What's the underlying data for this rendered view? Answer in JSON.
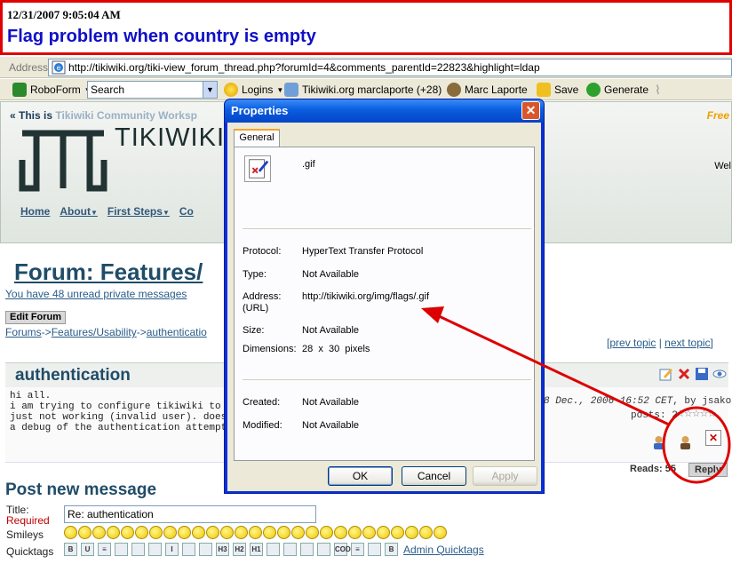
{
  "banner": {
    "timestamp": "12/31/2007 9:05:04 AM",
    "title": "Flag problem when country is empty"
  },
  "address_bar": {
    "label": "Address",
    "url": "http://tikiwiki.org/tiki-view_forum_thread.php?forumId=4&comments_parentId=22823&highlight=ldap"
  },
  "toolbar": {
    "roboform": "RoboForm",
    "search": "Search",
    "logins": "Logins",
    "bookmark": "Tikiwiki.org marclaporte (+28)",
    "user": "Marc Laporte",
    "save": "Save",
    "generate": "Generate"
  },
  "site": {
    "top_prefix": "« This is",
    "top_name": "Tikiwiki Community Worksp",
    "free": "Free",
    "welcome": "Wel",
    "logo_text": "TIKIWIKI",
    "menu": [
      "Home",
      "About",
      "First Steps",
      "Co"
    ]
  },
  "forum": {
    "title": "Forum: Features/",
    "unread": "You have 48 unread private messages",
    "edit_button": "Edit Forum",
    "crumbs": [
      "Forums",
      "Features/Usability",
      "authenticatio"
    ],
    "prev_topic": "prev topic",
    "next_topic": "next topic"
  },
  "thread": {
    "title": "authentication",
    "body": "hi all.\ni am trying to configure tikiwiki to authentic\njust not working (invalid user). does anyone\na debug of the authentication attempts?",
    "date": "8 Dec., 2006 16:52 CET",
    "by": ", by jsakofsky",
    "posts": "posts: 2",
    "reads": "Reads: 55",
    "reply": "Reply"
  },
  "post_form": {
    "heading": "Post new message",
    "title_label": "Title:",
    "required": "Required",
    "title_value": "Re: authentication",
    "smileys_label": "Smileys",
    "quicktags_label": "Quicktags",
    "admin_quicktags": "Admin Quicktags",
    "quicktag_glyphs": [
      "B",
      "U",
      "≡",
      "",
      "",
      "",
      "I",
      "",
      "",
      "H3",
      "H2",
      "H1",
      "",
      "",
      "",
      "",
      "CODE",
      "≡",
      "",
      "B"
    ]
  },
  "dialog": {
    "title": "Properties",
    "tab": "General",
    "file_name": ".gif",
    "protocol_label": "Protocol:",
    "protocol": "HyperText Transfer Protocol",
    "type_label": "Type:",
    "type": "Not Available",
    "address_label": "Address:\n(URL)",
    "address": "http://tikiwiki.org/img/flags/.gif",
    "size_label": "Size:",
    "size": "Not Available",
    "dimensions_label": "Dimensions:",
    "dimensions": "28  x  30  pixels",
    "created_label": "Created:",
    "created": "Not Available",
    "modified_label": "Modified:",
    "modified": "Not Available",
    "ok": "OK",
    "cancel": "Cancel",
    "apply": "Apply"
  },
  "colors": {
    "annotation_red": "#dd0000",
    "banner_title": "#1010c8",
    "xp_title_blue": "#0a5ddf",
    "forum_link": "#2a5c8a"
  }
}
